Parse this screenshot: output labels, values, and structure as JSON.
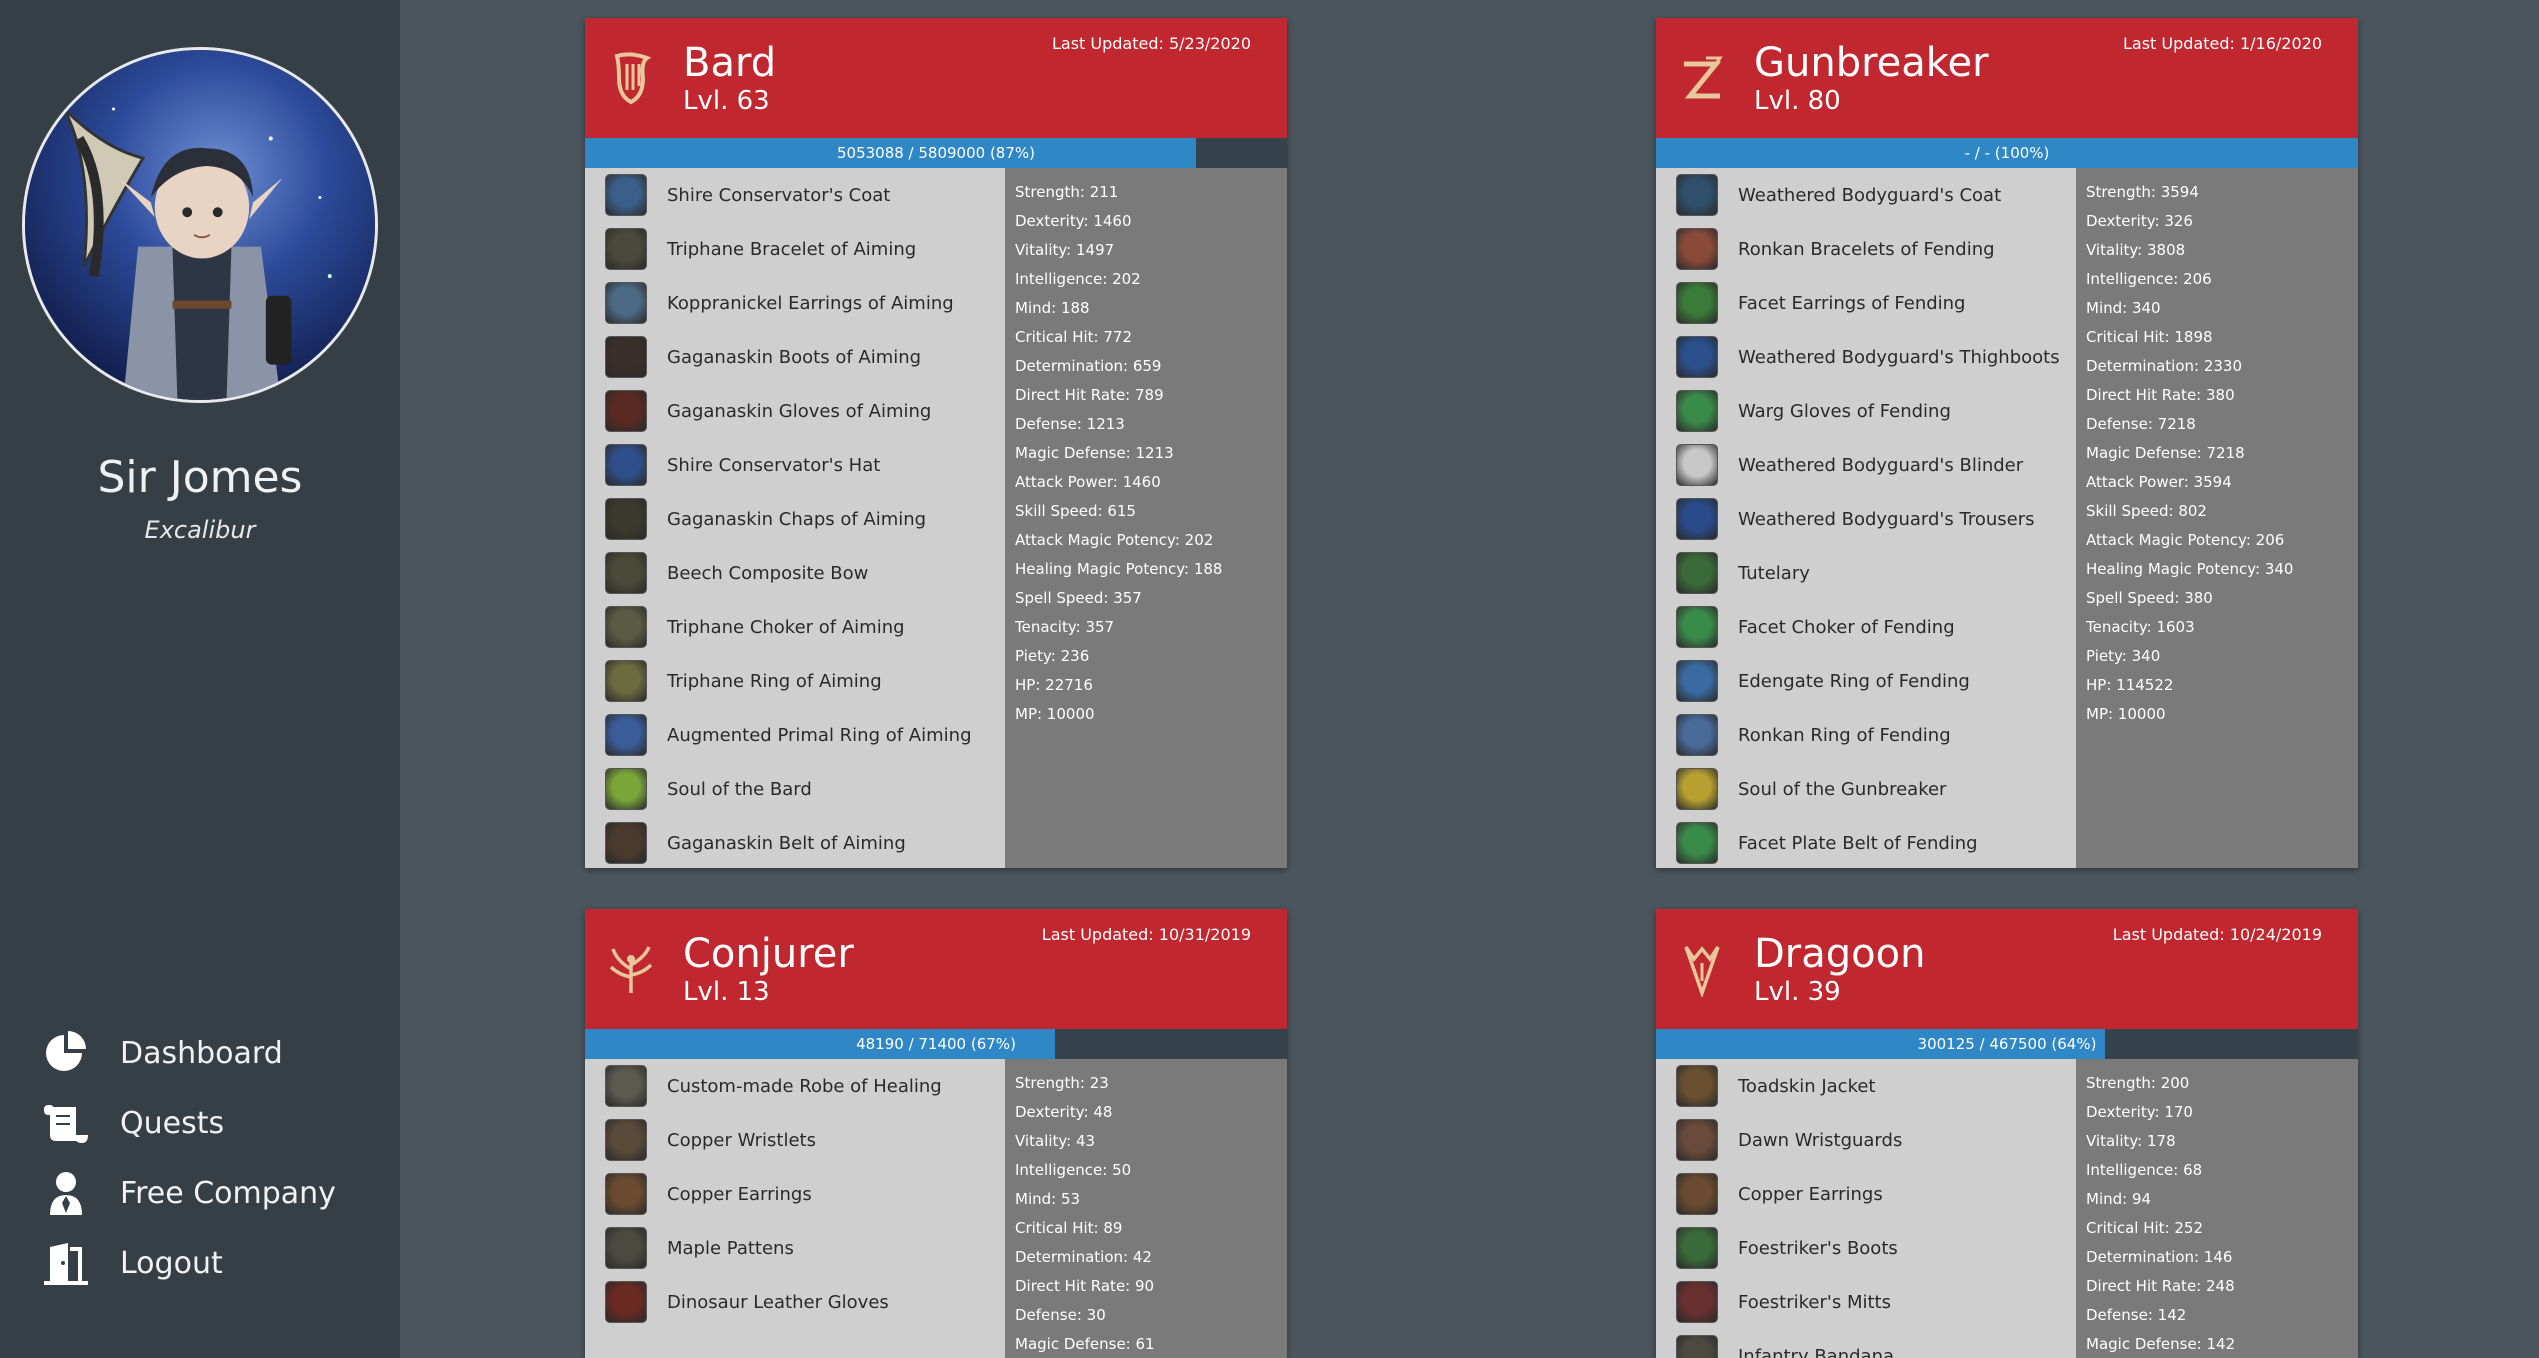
{
  "sidebar": {
    "character_name": "Sir Jomes",
    "server": "Excalibur",
    "nav": [
      {
        "label": "Dashboard",
        "icon": "pie-chart-icon"
      },
      {
        "label": "Quests",
        "icon": "scroll-icon"
      },
      {
        "label": "Free Company",
        "icon": "user-icon"
      },
      {
        "label": "Logout",
        "icon": "door-icon"
      }
    ]
  },
  "colors": {
    "header_red": "#c1272f",
    "xp_blue": "#2f87c6",
    "sidebar": "#363f46",
    "background": "#4b555d"
  },
  "jobs": [
    {
      "name": "Bard",
      "level": "Lvl. 63",
      "updated": "Last Updated: 5/23/2020",
      "xp_text": "5053088 / 5809000 (87%)",
      "xp_fraction": 0.87,
      "gear": [
        "Shire Conservator's Coat",
        "Triphane Bracelet of Aiming",
        "Koppranickel Earrings of Aiming",
        "Gaganaskin Boots of Aiming",
        "Gaganaskin Gloves of Aiming",
        "Shire Conservator's Hat",
        "Gaganaskin Chaps of Aiming",
        "Beech Composite Bow",
        "Triphane Choker of Aiming",
        "Triphane Ring of Aiming",
        "Augmented Primal Ring of Aiming",
        "Soul of the Bard",
        "Gaganaskin Belt of Aiming"
      ],
      "gear_colors": [
        "#3b5f8a",
        "#4a4a3a",
        "#4d6a85",
        "#3a2f2a",
        "#5a2a22",
        "#2f4f8a",
        "#3a3a2e",
        "#4a4a38",
        "#5b5b45",
        "#6b6b40",
        "#3a5d9a",
        "#7aa63a",
        "#4a3a2e"
      ],
      "stats": [
        "Strength: 211",
        "Dexterity: 1460",
        "Vitality: 1497",
        "Intelligence: 202",
        "Mind: 188",
        "Critical Hit: 772",
        "Determination: 659",
        "Direct Hit Rate: 789",
        "Defense: 1213",
        "Magic Defense: 1213",
        "Attack Power: 1460",
        "Skill Speed: 615",
        "Attack Magic Potency: 202",
        "Healing Magic Potency: 188",
        "Spell Speed: 357",
        "Tenacity: 357",
        "Piety: 236",
        "HP: 22716",
        "MP: 10000"
      ]
    },
    {
      "name": "Gunbreaker",
      "level": "Lvl. 80",
      "updated": "Last Updated: 1/16/2020",
      "xp_text": "- / - (100%)",
      "xp_fraction": 1.0,
      "gear": [
        "Weathered Bodyguard's Coat",
        "Ronkan Bracelets of Fending",
        "Facet Earrings of Fending",
        "Weathered Bodyguard's Thighboots",
        "Warg Gloves of Fending",
        "Weathered Bodyguard's Blinder",
        "Weathered Bodyguard's Trousers",
        "Tutelary",
        "Facet Choker of Fending",
        "Edengate Ring of Fending",
        "Ronkan Ring of Fending",
        "Soul of the Gunbreaker",
        "Facet Plate Belt of Fending"
      ],
      "gear_colors": [
        "#2f4f6a",
        "#8a4a3a",
        "#3a7a3a",
        "#2a4f8a",
        "#3a8a4a",
        "#c8c8c8",
        "#2a4a8a",
        "#3a6a3a",
        "#3a8a4a",
        "#3a6aa0",
        "#4a6a9a",
        "#b8a030",
        "#3a8a4a"
      ],
      "stats": [
        "Strength: 3594",
        "Dexterity: 326",
        "Vitality: 3808",
        "Intelligence: 206",
        "Mind: 340",
        "Critical Hit: 1898",
        "Determination: 2330",
        "Direct Hit Rate: 380",
        "Defense: 7218",
        "Magic Defense: 7218",
        "Attack Power: 3594",
        "Skill Speed: 802",
        "Attack Magic Potency: 206",
        "Healing Magic Potency: 340",
        "Spell Speed: 380",
        "Tenacity: 1603",
        "Piety: 340",
        "HP: 114522",
        "MP: 10000"
      ]
    },
    {
      "name": "Conjurer",
      "level": "Lvl. 13",
      "updated": "Last Updated: 10/31/2019",
      "xp_text": "48190 / 71400 (67%)",
      "xp_fraction": 0.67,
      "gear": [
        "Custom-made Robe of Healing",
        "Copper Wristlets",
        "Copper Earrings",
        "Maple Pattens",
        "Dinosaur Leather Gloves"
      ],
      "gear_colors": [
        "#5a5a50",
        "#5a4a3a",
        "#6a4a30",
        "#4a4a40",
        "#6a2a22"
      ],
      "stats": [
        "Strength: 23",
        "Dexterity: 48",
        "Vitality: 43",
        "Intelligence: 50",
        "Mind: 53",
        "Critical Hit: 89",
        "Determination: 42",
        "Direct Hit Rate: 90",
        "Defense: 30",
        "Magic Defense: 61"
      ]
    },
    {
      "name": "Dragoon",
      "level": "Lvl. 39",
      "updated": "Last Updated: 10/24/2019",
      "xp_text": "300125 / 467500 (64%)",
      "xp_fraction": 0.64,
      "gear": [
        "Toadskin Jacket",
        "Dawn Wristguards",
        "Copper Earrings",
        "Foestriker's Boots",
        "Foestriker's Mitts",
        "Infantry Bandana"
      ],
      "gear_colors": [
        "#6a5030",
        "#6a4a3a",
        "#6a4a30",
        "#3a6a3a",
        "#6a3030",
        "#4a4a40"
      ],
      "stats": [
        "Strength: 200",
        "Dexterity: 170",
        "Vitality: 178",
        "Intelligence: 68",
        "Mind: 94",
        "Critical Hit: 252",
        "Determination: 146",
        "Direct Hit Rate: 248",
        "Defense: 142",
        "Magic Defense: 142"
      ]
    }
  ]
}
